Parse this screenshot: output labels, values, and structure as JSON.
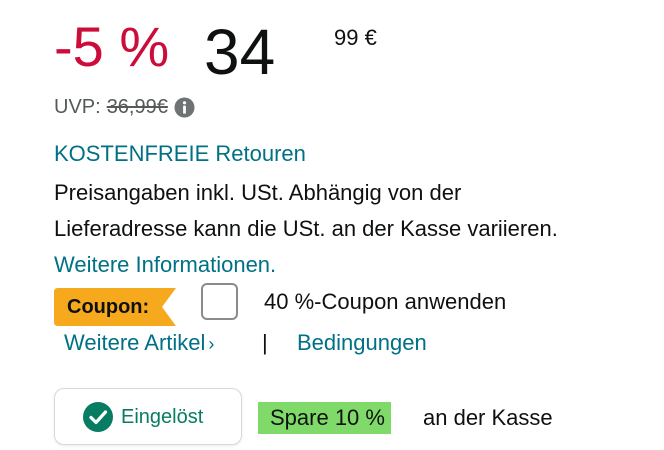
{
  "price": {
    "discount": "-5 %",
    "whole": "34",
    "fraction": "99",
    "currency": "€"
  },
  "uvp": {
    "label": "UVP:",
    "price": "36,99€",
    "info_icon": "info-icon"
  },
  "returns": {
    "label": "KOSTENFREIE Retouren"
  },
  "tax": {
    "text": "Preisangaben inkl. USt. Abhängig von der Lieferadresse kann die USt. an der Kasse variieren.",
    "link": "Weitere Informationen."
  },
  "coupon": {
    "badge": "Coupon:",
    "apply_label": "40 %-Coupon anwenden",
    "badge_color": "#f7a91e",
    "checked": false
  },
  "links": {
    "more_items": "Weitere Artikel",
    "more_items_chevron": "›",
    "separator": "|",
    "conditions": "Bedingungen"
  },
  "redeemed": {
    "label": "Eingelöst",
    "icon": "check-circle-icon",
    "color": "#067d62"
  },
  "savings": {
    "badge": "Spare 10 %",
    "suffix": "an der Kasse",
    "badge_color": "#7fda69"
  }
}
